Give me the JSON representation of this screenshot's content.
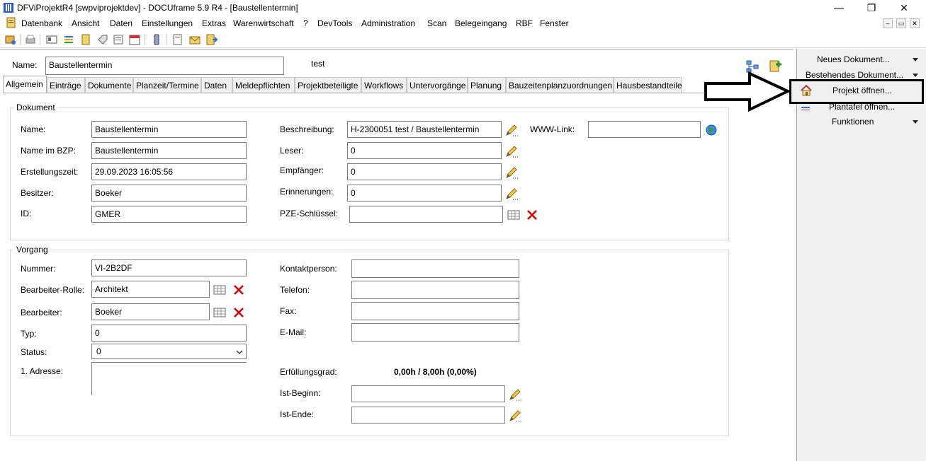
{
  "window": {
    "title": "DFViProjektR4 [swpviprojektdev] - DOCUframe 5.9 R4 - [Baustellentermin]",
    "minimize": "—",
    "restore": "❐",
    "close": "✕"
  },
  "menu": [
    "Datenbank",
    "Ansicht",
    "Daten",
    "Einstellungen",
    "Extras",
    "Warenwirtschaft",
    "?",
    "DevTools",
    "Administration",
    "Scan",
    "Belegeingang",
    "RBF",
    "Fenster"
  ],
  "mdi": {
    "minimize": "–",
    "restore": "▭",
    "close": "✕"
  },
  "header": {
    "name_label": "Name:",
    "name_value": "Baustellentermin",
    "extra_text": "test"
  },
  "tabs": [
    "Allgemein",
    "Einträge",
    "Dokumente",
    "Planzeit/Termine",
    "Daten",
    "Meldepflichten",
    "Projektbeteiligte",
    "Workflows",
    "Untervorgänge",
    "Planung",
    "Bauzeitenplanzuordnungen",
    "Hausbestandteile"
  ],
  "dokument": {
    "title": "Dokument",
    "name_label": "Name:",
    "name_value": "Baustellentermin",
    "bzp_label": "Name im BZP:",
    "bzp_value": "Baustellentermin",
    "created_label": "Erstellungszeit:",
    "created_value": "29.09.2023 16:05:56",
    "owner_label": "Besitzer:",
    "owner_value": "Boeker",
    "id_label": "ID:",
    "id_value": "GMER",
    "desc_label": "Beschreibung:",
    "desc_value": "H-2300051 test / Baustellentermin",
    "reader_label": "Leser:",
    "reader_value": "0",
    "recipient_label": "Empfänger:",
    "recipient_value": "0",
    "reminder_label": "Erinnerungen:",
    "reminder_value": "0",
    "pze_label": "PZE-Schlüssel:",
    "pze_value": "",
    "www_label": "WWW-Link:",
    "www_value": ""
  },
  "vorgang": {
    "title": "Vorgang",
    "number_label": "Nummer:",
    "number_value": "VI-2B2DF",
    "role_label": "Bearbeiter-Rolle:",
    "role_value": "Architekt",
    "editor_label": "Bearbeiter:",
    "editor_value": "Boeker",
    "type_label": "Typ:",
    "type_value": "0",
    "status_label": "Status:",
    "status_value": "0",
    "address_label": "1. Adresse:",
    "address_value": "",
    "contact_label": "Kontaktperson:",
    "contact_value": "",
    "phone_label": "Telefon:",
    "phone_value": "",
    "fax_label": "Fax:",
    "fax_value": "",
    "email_label": "E-Mail:",
    "email_value": "",
    "progress_label": "Erfüllungsgrad:",
    "progress_value": "0,00h / 8,00h (0,00%)",
    "start_label": "Ist-Beginn:",
    "start_value": "",
    "end_label": "Ist-Ende:",
    "end_value": ""
  },
  "side": {
    "new_doc": "Neues Dokument...",
    "existing_doc": "Bestehendes Dokument...",
    "open_project": "Projekt öffnen...",
    "plantafel": "Plantafel öffnen...",
    "functions": "Funktionen"
  },
  "colors": {
    "highlight_border": "#000000",
    "panel_bg": "#f0f0f0",
    "cross_red": "#d40000"
  }
}
